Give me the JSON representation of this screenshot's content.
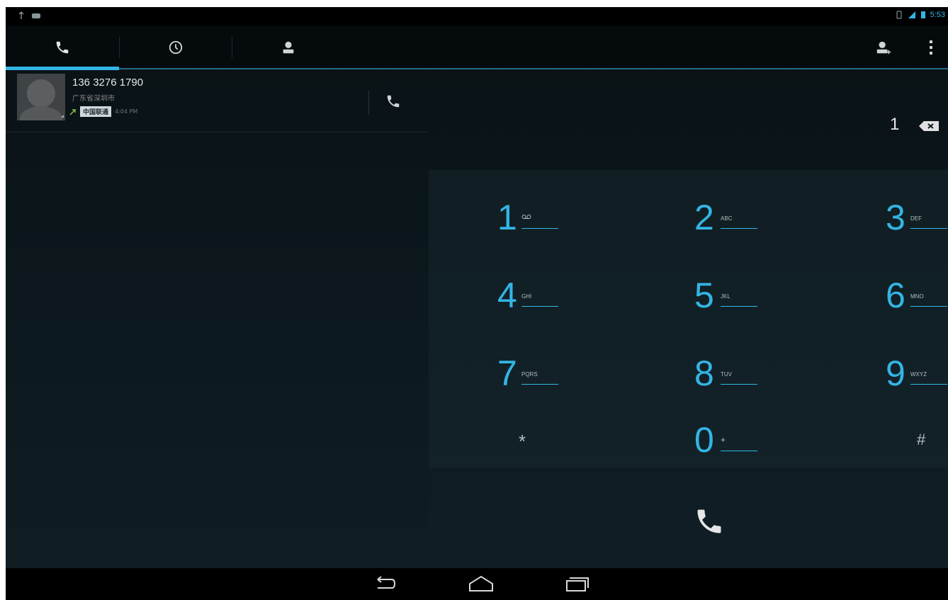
{
  "status_bar": {
    "time": "5:53"
  },
  "tabs": [
    {
      "name": "phone",
      "icon": "phone-icon",
      "selected": true
    },
    {
      "name": "call-log",
      "icon": "clock-icon",
      "selected": false
    },
    {
      "name": "contacts",
      "icon": "person-icon",
      "selected": false
    }
  ],
  "action_bar": {
    "add_contact_icon": "add-contact-icon",
    "overflow_icon": "overflow-menu-icon"
  },
  "call_log": {
    "number": "136 3276 1790",
    "location": "广东省深圳市",
    "carrier": "中国联通",
    "time": "4:04 PM"
  },
  "dial_display": {
    "digits": "1"
  },
  "keypad": {
    "keys": [
      {
        "digit": "1",
        "letters": "ꝏ"
      },
      {
        "digit": "2",
        "letters": "ABC"
      },
      {
        "digit": "3",
        "letters": "DEF"
      },
      {
        "digit": "4",
        "letters": "GHI"
      },
      {
        "digit": "5",
        "letters": "JKL"
      },
      {
        "digit": "6",
        "letters": "MNO"
      },
      {
        "digit": "7",
        "letters": "PQRS"
      },
      {
        "digit": "8",
        "letters": "TUV"
      },
      {
        "digit": "9",
        "letters": "WXYZ"
      },
      {
        "digit": "*",
        "letters": ""
      },
      {
        "digit": "0",
        "letters": "+"
      },
      {
        "digit": "#",
        "letters": ""
      }
    ]
  },
  "colors": {
    "accent": "#33b5e5",
    "background": "#0b161b"
  },
  "nav": {
    "back_icon": "back-icon",
    "home_icon": "home-icon",
    "recents_icon": "recent-apps-icon"
  }
}
